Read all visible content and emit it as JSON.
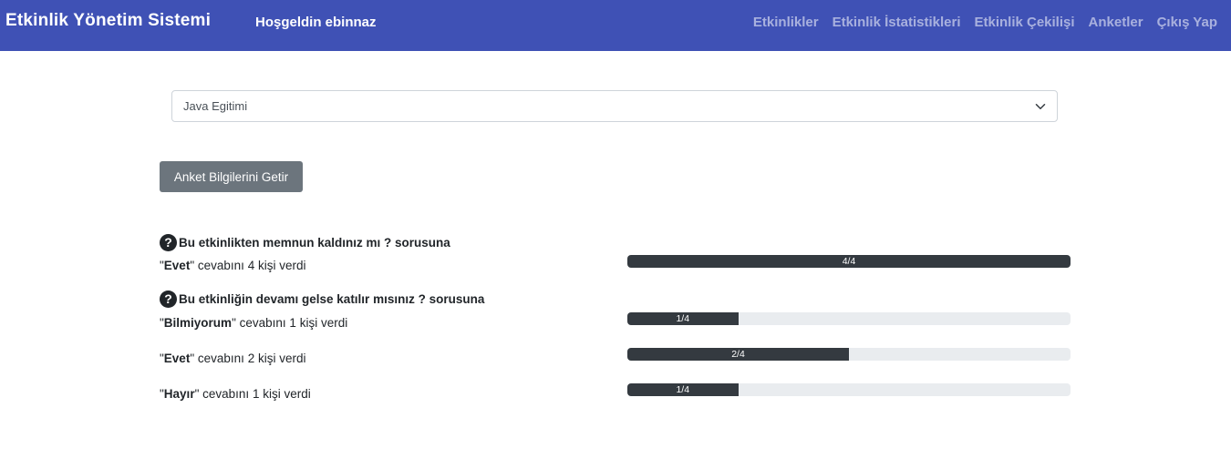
{
  "navbar": {
    "brand": "Etkinlik Yönetim Sistemi",
    "welcome": "Hoşgeldin ebinnaz",
    "links": [
      "Etkinlikler",
      "Etkinlik İstatistikleri",
      "Etkinlik Çekilişi",
      "Anketler",
      "Çıkış Yap"
    ]
  },
  "event_select": {
    "value": "Java Egitimi"
  },
  "fetch_button": {
    "label": "Anket Bilgilerini Getir"
  },
  "answer_suffix": "cevabını",
  "answer_tail": "kişi verdi",
  "questions": [
    {
      "text": "Bu etkinlikten memnun kaldınız mı ? sorusuna",
      "answers": [
        {
          "label": "Evet",
          "count": 4,
          "total": 4,
          "bar_text": "4/4"
        }
      ]
    },
    {
      "text": "Bu etkinliğin devamı gelse katılır mısınız ? sorusuna",
      "answers": [
        {
          "label": "Bilmiyorum",
          "count": 1,
          "total": 4,
          "bar_text": "1/4"
        },
        {
          "label": "Evet",
          "count": 2,
          "total": 4,
          "bar_text": "2/4"
        },
        {
          "label": "Hayır",
          "count": 1,
          "total": 4,
          "bar_text": "1/4"
        }
      ]
    }
  ]
}
